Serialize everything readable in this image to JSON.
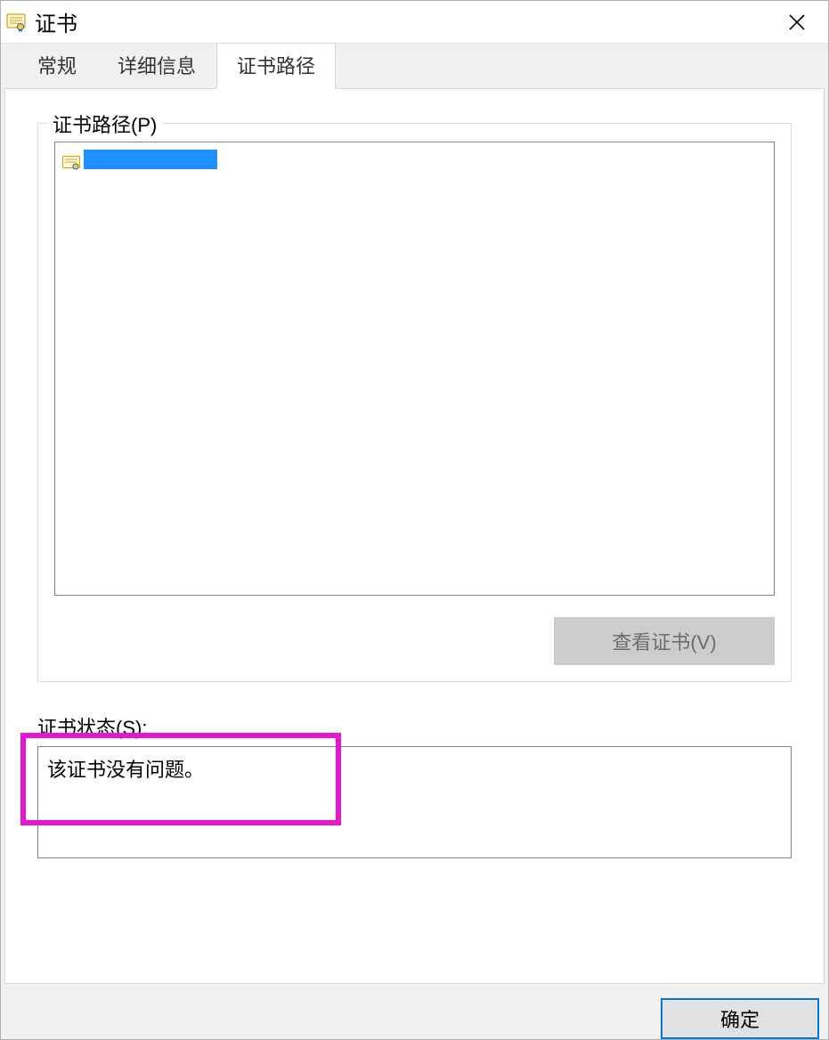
{
  "window": {
    "title": "证书"
  },
  "tabs": {
    "general": "常规",
    "details": "详细信息",
    "path": "证书路径"
  },
  "path_group": {
    "legend": "证书路径(P)",
    "item_label": "",
    "view_cert_btn": "查看证书(V)"
  },
  "status": {
    "label": "证书状态(S):",
    "value": "该证书没有问题。"
  },
  "footer": {
    "ok": "确定"
  }
}
